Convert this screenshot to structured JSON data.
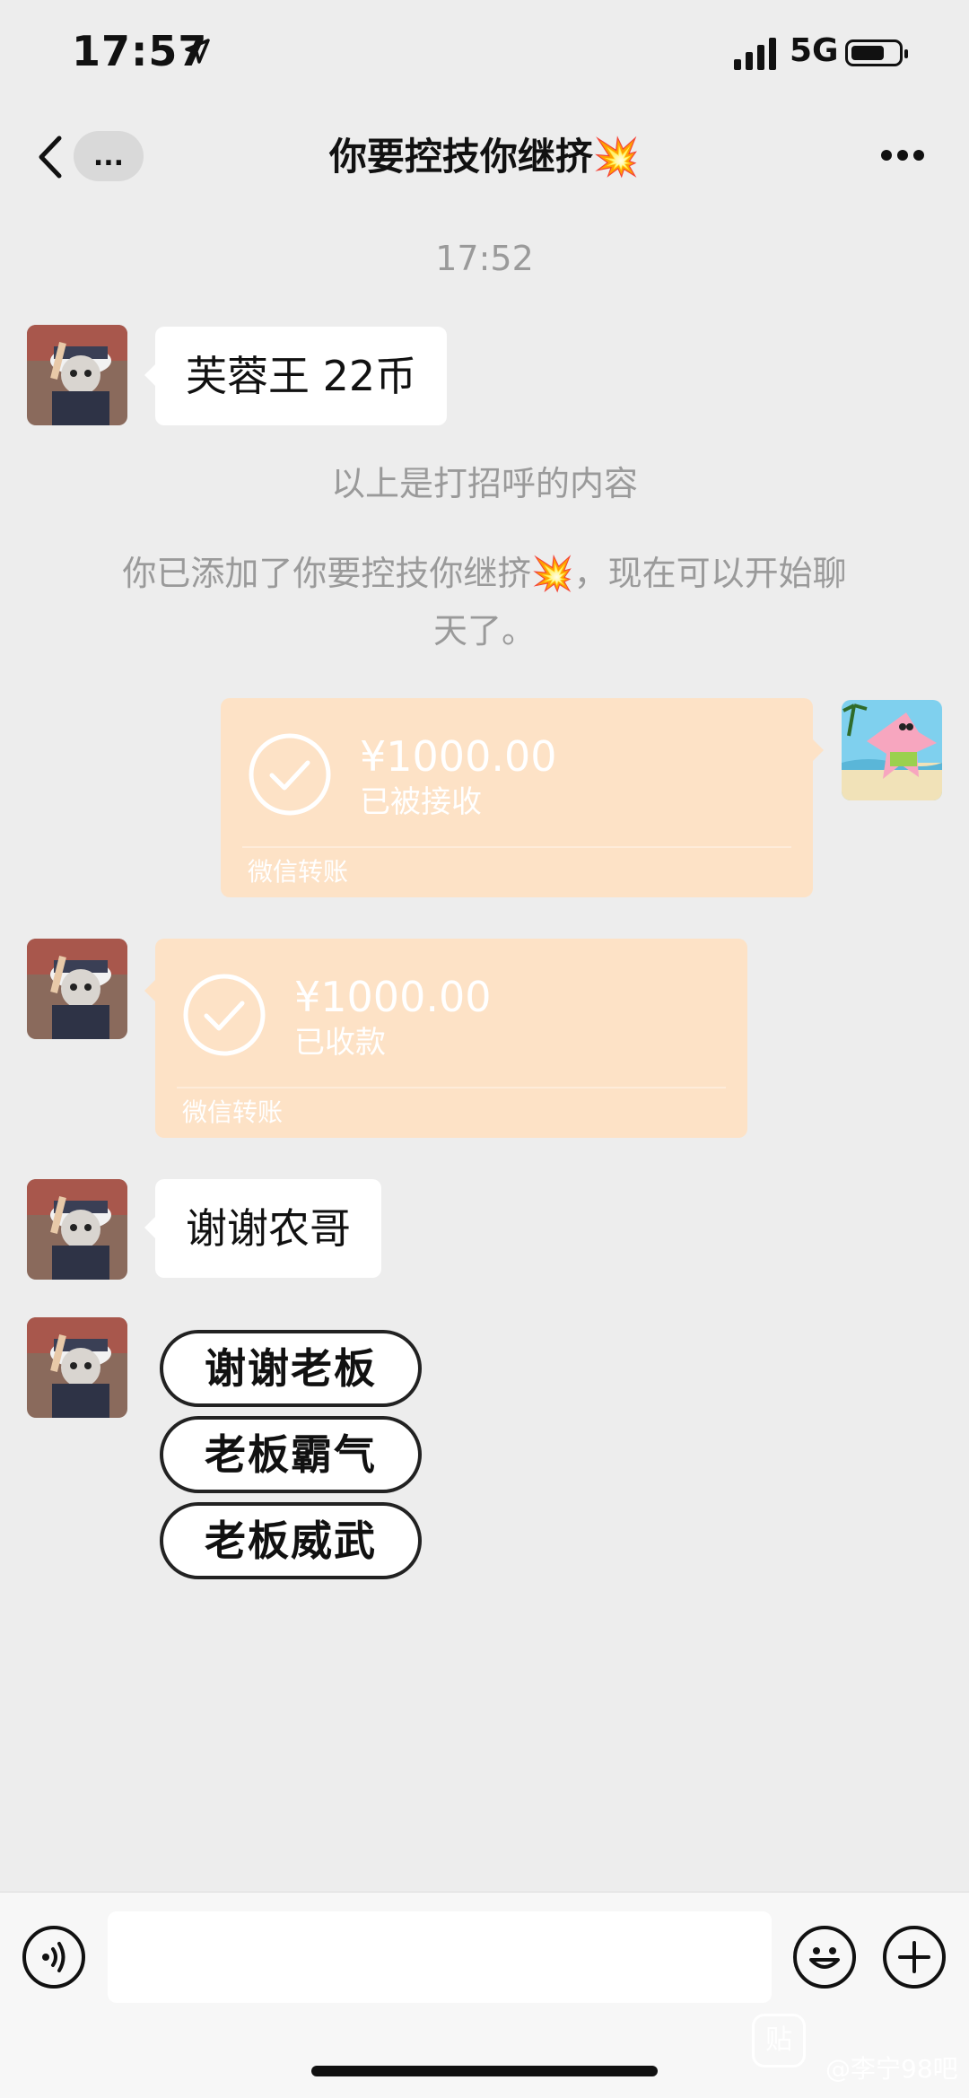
{
  "status_bar": {
    "time": "17:57",
    "network": "5G",
    "location_icon": "location-arrow-icon",
    "battery_level": 0.7
  },
  "nav": {
    "unread_badge": "...",
    "title": "你要控技你继挤💥"
  },
  "chat": {
    "timestamp": "17:52",
    "greeting_message": "芙蓉王 22币",
    "system_notice_1": "以上是打招呼的内容",
    "system_notice_2_line1": "你已添加了你要控技你继挤💥，现在可以开始聊",
    "system_notice_2_line2": "天了。",
    "transfer_sent": {
      "amount": "¥1000.00",
      "status": "已被接收",
      "label": "微信转账"
    },
    "transfer_received": {
      "amount": "¥1000.00",
      "status": "已收款",
      "label": "微信转账"
    },
    "thanks_message": "谢谢农哥",
    "stickers": [
      "谢谢老板",
      "老板霸气",
      "老板威武"
    ]
  },
  "watermark": {
    "logo": "贴",
    "text": "@李宁98吧"
  },
  "colors": {
    "background": "#ededed",
    "transfer_bubble": "#fde2c6",
    "system_text": "#9a9a9a"
  }
}
